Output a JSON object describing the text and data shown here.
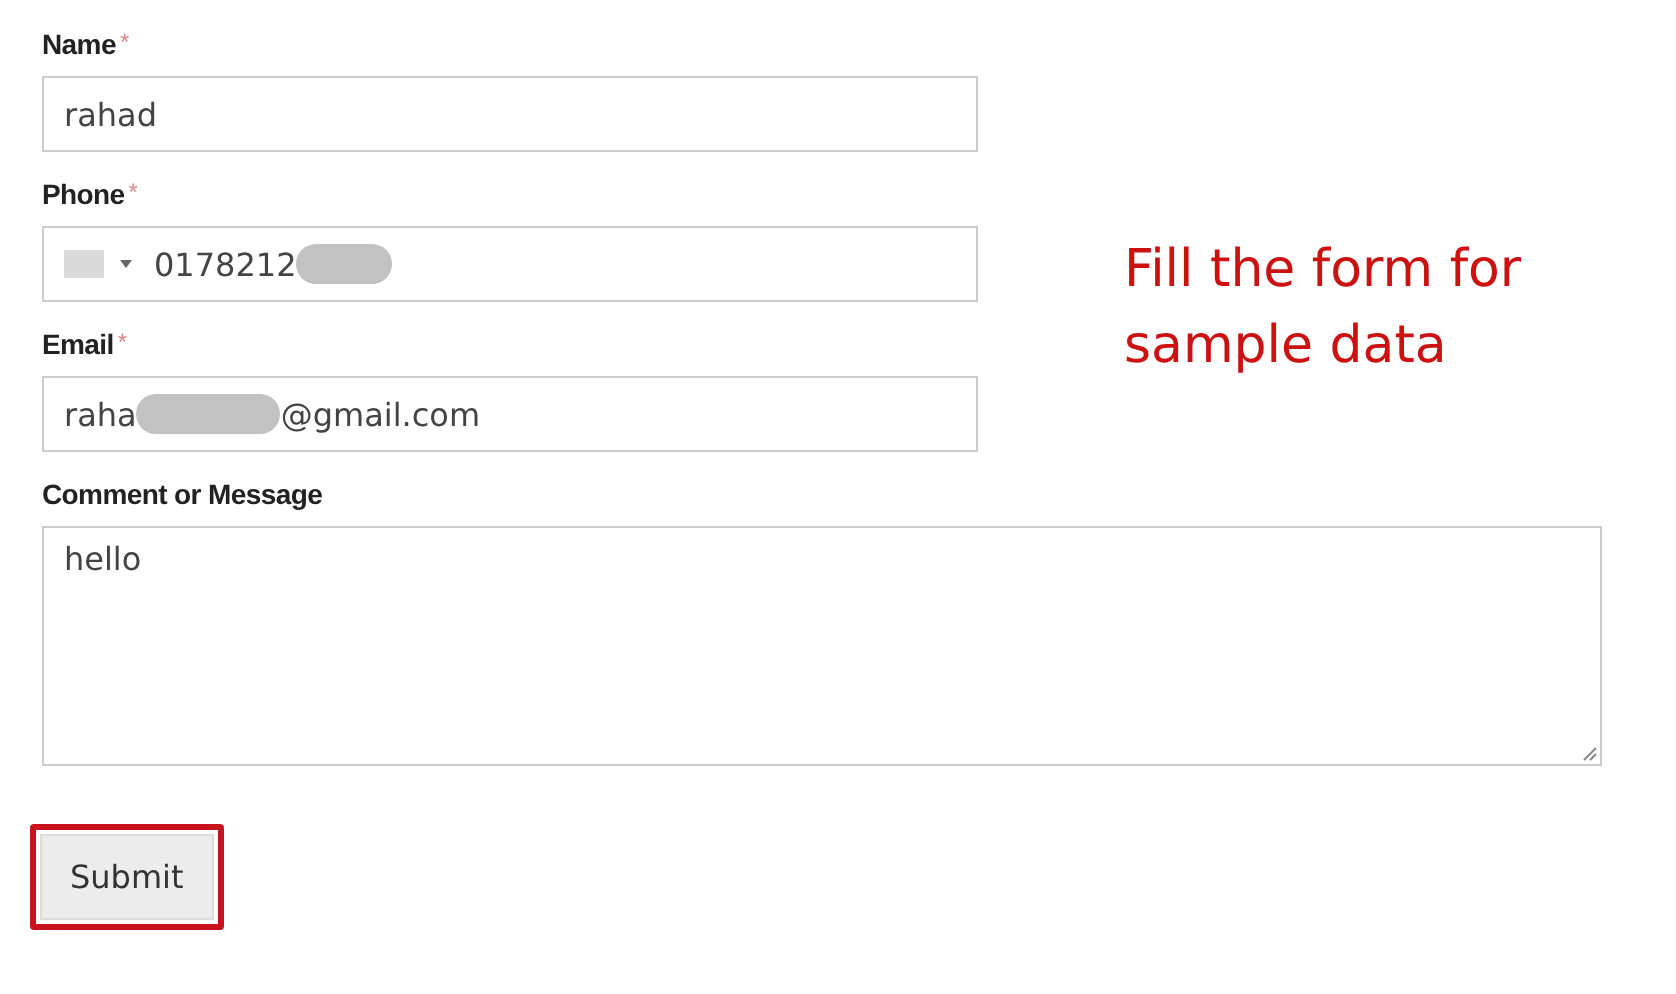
{
  "fields": [
    {
      "kind": "text",
      "label": "Name",
      "required_mark": "*",
      "value": "rahad"
    },
    {
      "kind": "phone",
      "label": "Phone",
      "required_mark": "*",
      "value": "0178212",
      "redacted": true
    },
    {
      "kind": "email",
      "label": "Email",
      "required_mark": "*",
      "value": "raha",
      "value_after_redaction": "@gmail.com",
      "redacted": true
    }
  ],
  "note": "Fill the form for sample data",
  "message": {
    "label": "Comment or Message",
    "value": "hello"
  },
  "submit": {
    "label": "Submit",
    "highlighted": true
  }
}
